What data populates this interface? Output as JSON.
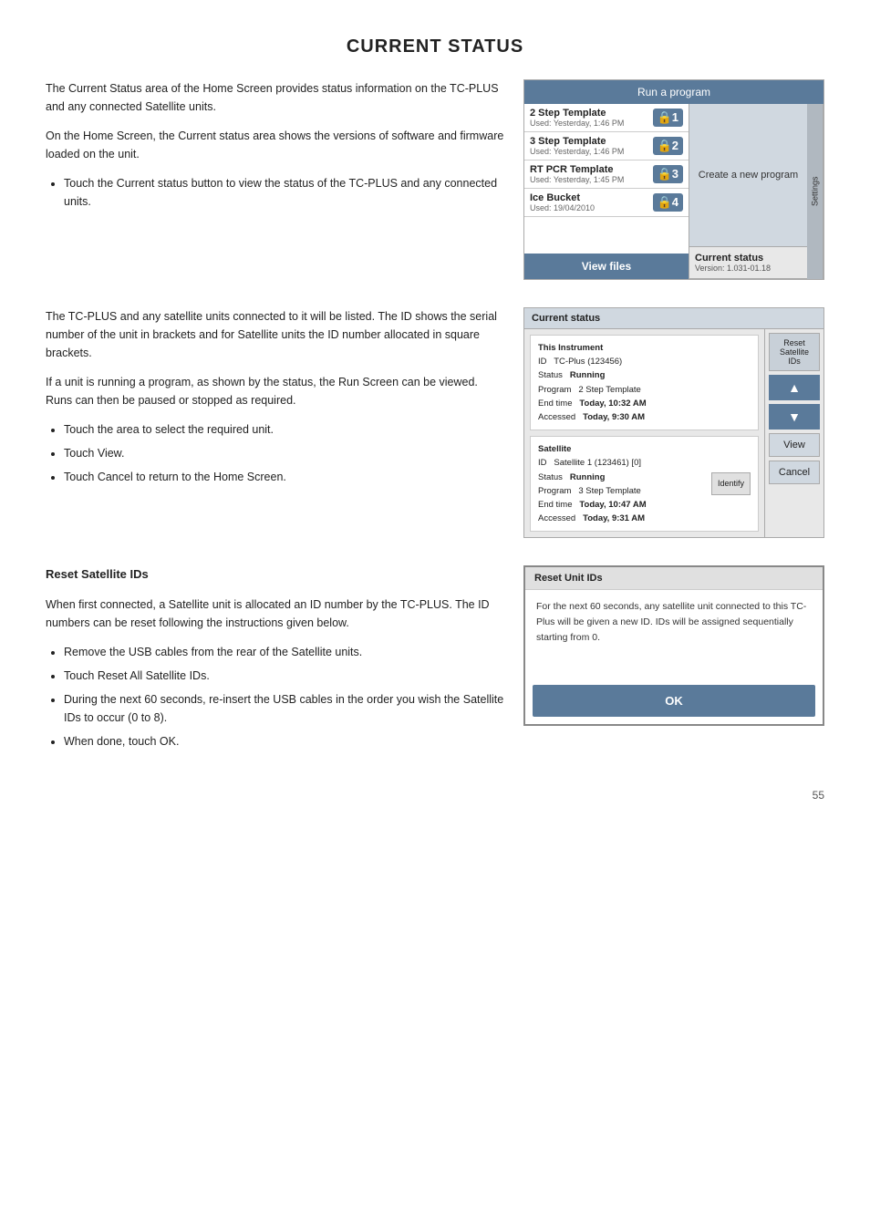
{
  "page": {
    "title": "CURRENT STATUS",
    "page_number": "55"
  },
  "intro": {
    "para1": "The Current Status area of the Home Screen provides status information on the TC-PLUS and any connected Satellite units.",
    "para2": "On the Home Screen, the Current status area shows the versions of software and firmware loaded on the unit.",
    "bullet1": "Touch the Current status button to view the status of the TC-PLUS and any connected units."
  },
  "home_screen": {
    "run_program_label": "Run a program",
    "items": [
      {
        "name": "2 Step Template",
        "used": "Used: Yesterday, 1:46 PM",
        "num": "1"
      },
      {
        "name": "3 Step Template",
        "used": "Used: Yesterday, 1:46 PM",
        "num": "2"
      },
      {
        "name": "RT PCR Template",
        "used": "Used: Yesterday, 1:45 PM",
        "num": "3"
      },
      {
        "name": "Ice Bucket",
        "used": "Used: 19/04/2010",
        "num": "4"
      }
    ],
    "create_new": "Create a new program",
    "current_status_label": "Current status",
    "current_status_version": "Version: 1.031-01.18",
    "settings_label": "Settings",
    "view_files_label": "View files"
  },
  "section2": {
    "para1": "The TC-PLUS and any satellite units connected to it will be listed. The ID shows the serial number of the unit in brackets and for Satellite units the ID number allocated in square brackets.",
    "para2": "If a unit is running a program, as shown by the status, the Run Screen can be viewed. Runs can then be paused or stopped as required.",
    "bullets": [
      "Touch the area to select the required unit.",
      "Touch View.",
      "Touch Cancel to return to the Home Screen."
    ]
  },
  "current_status_screen": {
    "header": "Current status",
    "instrument_section": "This Instrument",
    "instrument_id": "ID  TC-Plus (123456)",
    "instrument_status": "Status  Running",
    "instrument_program": "Program  2 Step Template",
    "instrument_endtime": "End time  Today, 10:32 AM",
    "instrument_accessed": "Accessed  Today, 9:30 AM",
    "satellite_section": "Satellite",
    "satellite_id": "ID  Satellite 1 (123461) [0]",
    "satellite_status": "Status  Running",
    "satellite_program": "Program  3 Step Template",
    "satellite_endtime": "End time  Today, 10:47 AM",
    "satellite_accessed": "Accessed  Today, 9:31 AM",
    "identify_label": "Identify",
    "reset_satellite_ids_label": "Reset\nSatellite\nIDs",
    "up_arrow": "▲",
    "down_arrow": "▼",
    "view_label": "View",
    "cancel_label": "Cancel"
  },
  "reset_section": {
    "heading": "Reset Satellite IDs",
    "para1": "When first connected, a Satellite unit is allocated an ID number by the TC-PLUS. The ID numbers can be reset following the instructions given below.",
    "bullets": [
      "Remove the USB cables from the rear of the Satellite units.",
      "Touch Reset All Satellite IDs.",
      "During the next 60 seconds, re-insert the USB cables in the order you wish the Satellite IDs to occur (0 to 8).",
      "When done, touch OK."
    ],
    "reset_screen_header": "Reset Unit IDs",
    "reset_screen_body": "For the next 60 seconds, any satellite unit connected to this TC-Plus will be given a new ID. IDs will be assigned sequentially starting from 0.",
    "ok_label": "OK"
  }
}
